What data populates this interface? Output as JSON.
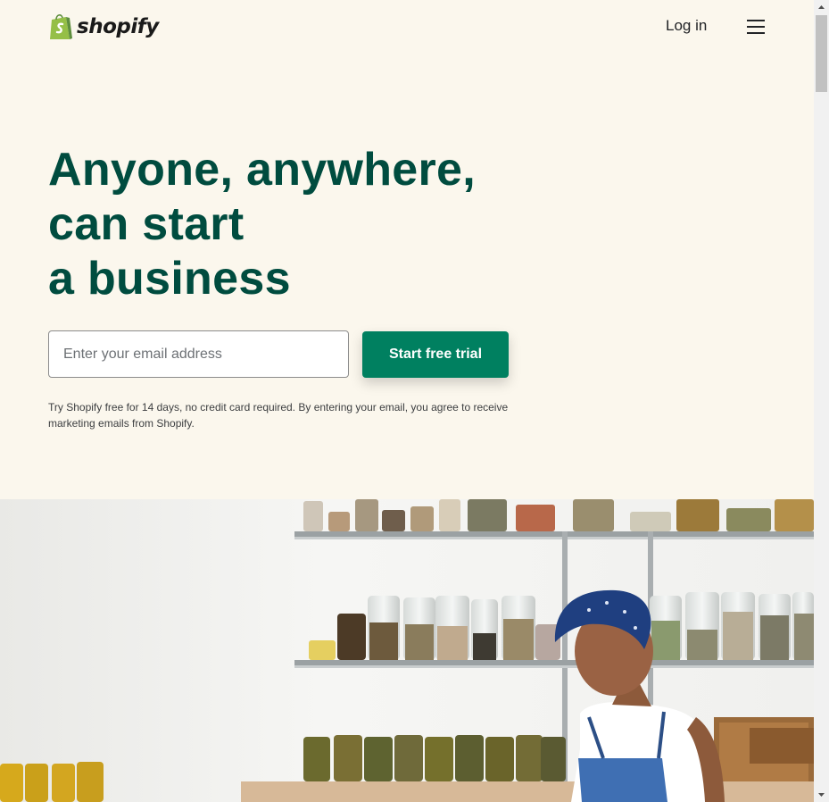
{
  "header": {
    "logo_text": "shopify",
    "login_label": "Log in",
    "menu_icon": "hamburger-menu-icon"
  },
  "hero": {
    "headline_lines": [
      "Anyone, anywhere,",
      "can start",
      "a business"
    ],
    "email_placeholder": "Enter your email address",
    "cta_label": "Start free trial",
    "disclaimer": "Try Shopify free for 14 days, no credit card required. By entering your email, you agree to receive marketing emails from Shopify."
  },
  "colors": {
    "background": "#fbf7ed",
    "headline": "#004c3f",
    "cta": "#008060",
    "logo_green": "#95bf47"
  }
}
